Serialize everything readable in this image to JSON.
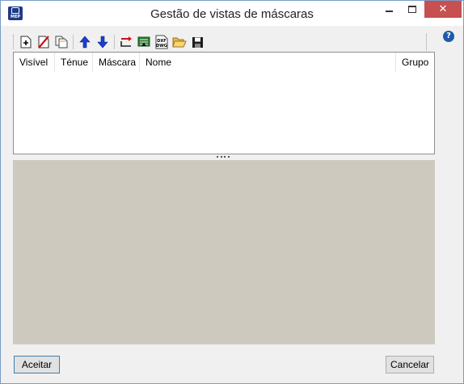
{
  "window": {
    "title": "Gestão de vistas de máscaras",
    "app_icon_text": "MEP",
    "close_glyph": "✕"
  },
  "toolbar": {
    "buttons": [
      {
        "name": "new-icon"
      },
      {
        "name": "delete-icon"
      },
      {
        "name": "copy-icon"
      },
      {
        "name": "move-up-icon"
      },
      {
        "name": "move-down-icon"
      },
      {
        "name": "assign-icon"
      },
      {
        "name": "import-icon"
      },
      {
        "name": "dxf-dwg-icon",
        "text": "DXF DWG"
      },
      {
        "name": "open-folder-icon"
      },
      {
        "name": "save-icon"
      }
    ],
    "help_text": "?"
  },
  "table": {
    "columns": [
      "Visível",
      "Ténue",
      "Máscara",
      "Nome",
      "Grupo"
    ],
    "rows": []
  },
  "buttons": {
    "accept": "Aceitar",
    "cancel": "Cancelar"
  },
  "colors": {
    "accent_blue": "#1e5aa8",
    "close_red": "#c75050",
    "preview_bg": "#cdc9bf"
  }
}
